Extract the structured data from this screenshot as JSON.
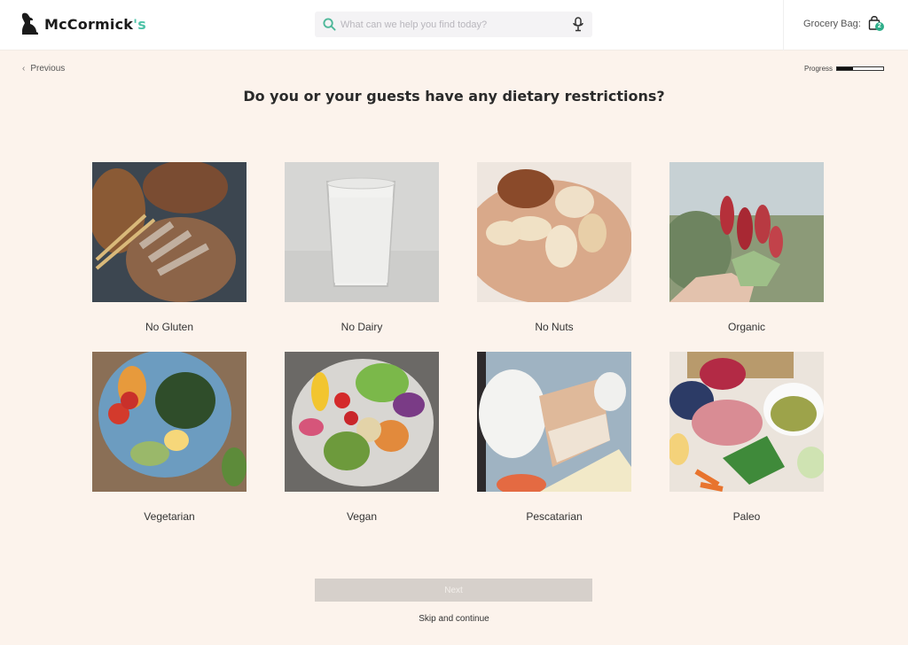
{
  "header": {
    "brand": "McCormick",
    "brand_apostrophe": "'s",
    "search": {
      "placeholder": "What can we help you find today?",
      "value": ""
    },
    "bag": {
      "label": "Grocery Bag:",
      "count": "2"
    },
    "colors": {
      "accent": "#2fae8a",
      "search_icon": "#4fb89a"
    }
  },
  "nav": {
    "previous_label": "Previous",
    "progress_label": "Progress",
    "progress_fraction": 0.35
  },
  "question": "Do you or your guests have any dietary restrictions?",
  "options": [
    {
      "label": "No Gluten",
      "image": "bread-loaves"
    },
    {
      "label": "No Dairy",
      "image": "glass-of-milk"
    },
    {
      "label": "No Nuts",
      "image": "mixed-nuts"
    },
    {
      "label": "Organic",
      "image": "radish-bunch"
    },
    {
      "label": "Vegetarian",
      "image": "salad-bowl-with-egg"
    },
    {
      "label": "Vegan",
      "image": "vegan-bowl"
    },
    {
      "label": "Pescatarian",
      "image": "fish-plate"
    },
    {
      "label": "Paleo",
      "image": "paleo-platter"
    }
  ],
  "footer": {
    "next_label": "Next",
    "skip_label": "Skip and continue"
  }
}
